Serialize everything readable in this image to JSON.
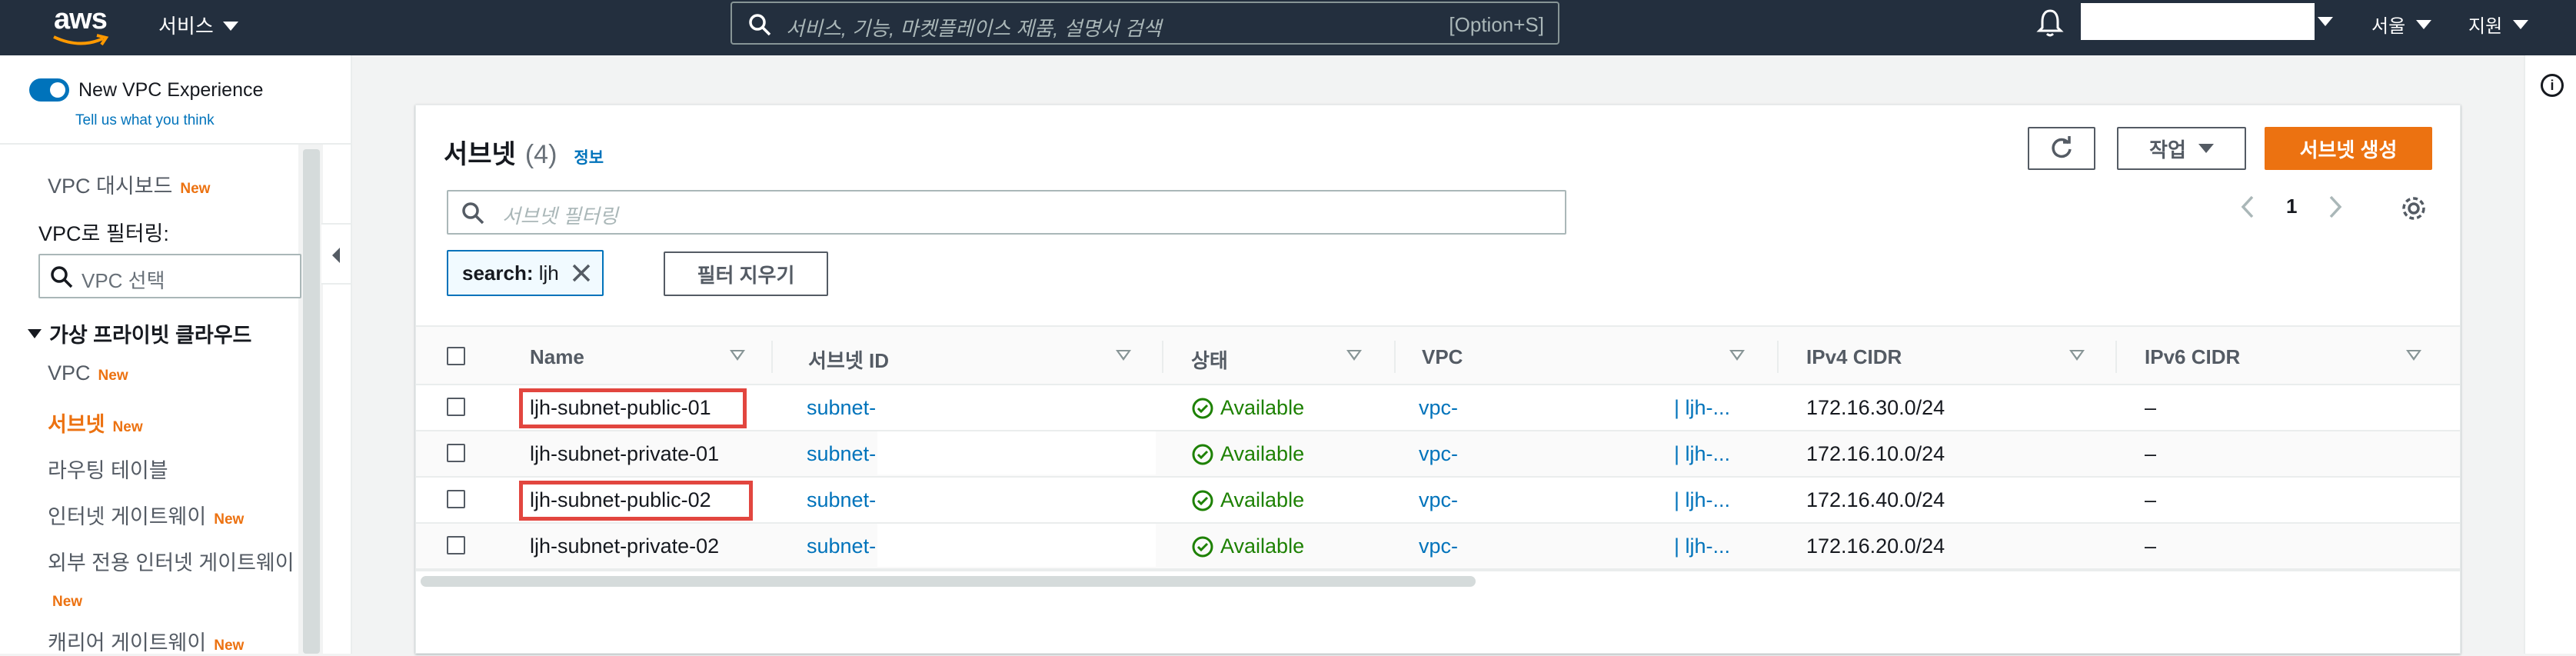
{
  "topnav": {
    "logo_text": "aws",
    "services_label": "서비스",
    "search_placeholder": "서비스, 기능, 마켓플레이스 제품, 설명서 검색",
    "search_shortcut": "[Option+S]",
    "region_label": "서울",
    "support_label": "지원"
  },
  "sidebar": {
    "toggle_label": "New VPC Experience",
    "tell_us": "Tell us what you think",
    "items": [
      {
        "label": "VPC 대시보드",
        "new": "New"
      },
      {
        "label": "VPC",
        "new": "New"
      },
      {
        "label": "서브넷",
        "new": "New"
      },
      {
        "label": "라우팅 테이블",
        "new": ""
      },
      {
        "label": "인터넷 게이트웨이",
        "new": "New"
      },
      {
        "label": "외부 전용 인터넷 게이트웨이",
        "new": "New"
      },
      {
        "label": "캐리어 게이트웨이",
        "new": "New"
      }
    ],
    "filter_label": "VPC로 필터링:",
    "vpc_select_placeholder": "VPC 선택",
    "section_title": "가상 프라이빗 클라우드"
  },
  "panel": {
    "title": "서브넷",
    "count": "(4)",
    "info_link": "정보",
    "actions_label": "작업",
    "create_label": "서브넷 생성",
    "filter_placeholder": "서브넷 필터링",
    "page_number": "1",
    "token_key": "search:",
    "token_value": "ljh",
    "clear_filters_label": "필터 지우기"
  },
  "table": {
    "columns": [
      "Name",
      "서브넷 ID",
      "상태",
      "VPC",
      "IPv4 CIDR",
      "IPv6 CIDR"
    ],
    "rows": [
      {
        "name": "ljh-subnet-public-01",
        "subnet_id": "subnet-",
        "status": "Available",
        "vpc": "vpc-",
        "vpc_name": "| ljh-...",
        "ipv4": "172.16.30.0/24",
        "ipv6": "–",
        "highlighted": true
      },
      {
        "name": "ljh-subnet-private-01",
        "subnet_id": "subnet-",
        "status": "Available",
        "vpc": "vpc-",
        "vpc_name": "| ljh-...",
        "ipv4": "172.16.10.0/24",
        "ipv6": "–",
        "highlighted": false
      },
      {
        "name": "ljh-subnet-public-02",
        "subnet_id": "subnet-",
        "status": "Available",
        "vpc": "vpc-",
        "vpc_name": "| ljh-...",
        "ipv4": "172.16.40.0/24",
        "ipv6": "–",
        "highlighted": true
      },
      {
        "name": "ljh-subnet-private-02",
        "subnet_id": "subnet-",
        "status": "Available",
        "vpc": "vpc-",
        "vpc_name": "| ljh-...",
        "ipv4": "172.16.20.0/24",
        "ipv6": "–",
        "highlighted": false
      }
    ]
  },
  "colors": {
    "nav_bg": "#232f3e",
    "accent_orange": "#ec7211",
    "link_blue": "#0073bb",
    "status_green": "#1d8102",
    "highlight_red": "#e2463f"
  }
}
